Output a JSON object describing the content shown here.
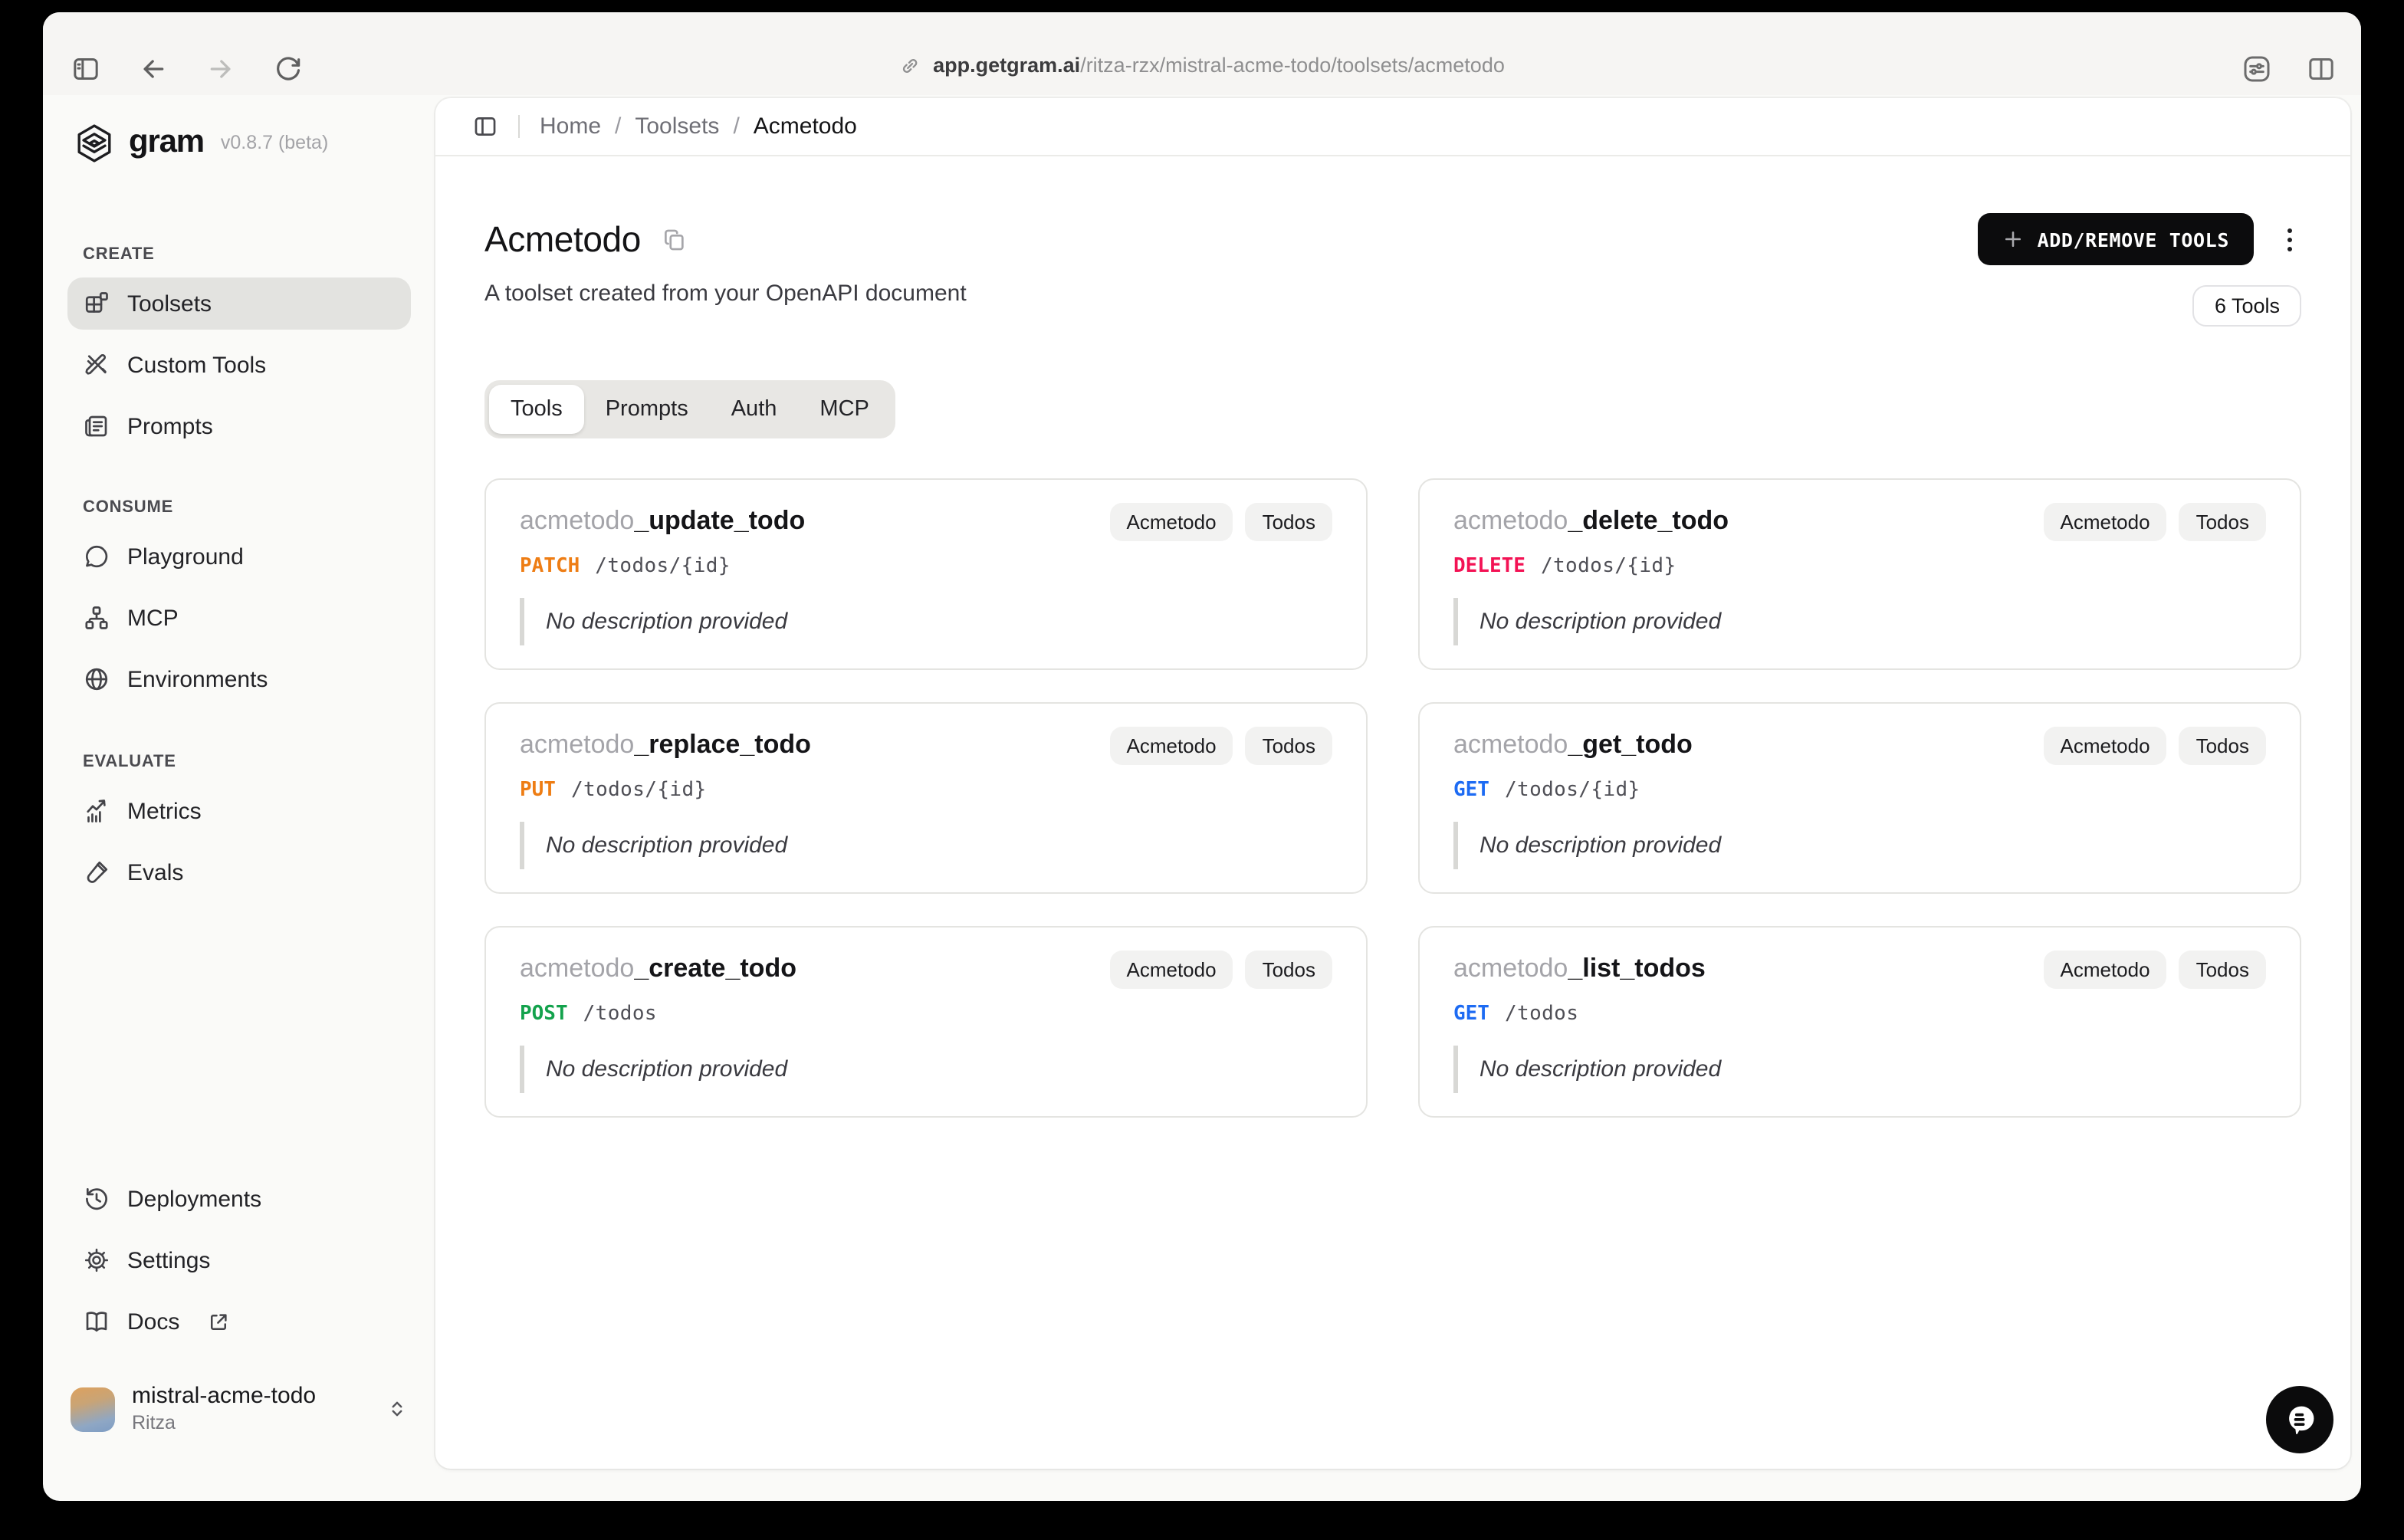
{
  "browser": {
    "url_host": "app.getgram.ai",
    "url_path": "/ritza-rzx/mistral-acme-todo/toolsets/acmetodo"
  },
  "sidebar": {
    "logo_text": "gram",
    "version": "v0.8.7 (beta)",
    "sections": [
      {
        "label": "CREATE",
        "items": [
          {
            "label": "Toolsets",
            "icon": "toolsets-icon",
            "active": true
          },
          {
            "label": "Custom Tools",
            "icon": "custom-tools-icon",
            "active": false
          },
          {
            "label": "Prompts",
            "icon": "prompts-icon",
            "active": false
          }
        ]
      },
      {
        "label": "CONSUME",
        "items": [
          {
            "label": "Playground",
            "icon": "playground-chat-icon",
            "active": false
          },
          {
            "label": "MCP",
            "icon": "mcp-network-icon",
            "active": false
          },
          {
            "label": "Environments",
            "icon": "environments-globe-icon",
            "active": false
          }
        ]
      },
      {
        "label": "EVALUATE",
        "items": [
          {
            "label": "Metrics",
            "icon": "metrics-chart-icon",
            "active": false
          },
          {
            "label": "Evals",
            "icon": "evals-testtube-icon",
            "active": false
          }
        ]
      }
    ],
    "footer_items": [
      {
        "label": "Deployments",
        "icon": "deployments-history-icon"
      },
      {
        "label": "Settings",
        "icon": "settings-gear-icon"
      },
      {
        "label": "Docs",
        "icon": "docs-book-icon",
        "external": true
      }
    ],
    "workspace": {
      "name": "mistral-acme-todo",
      "org": "Ritza"
    }
  },
  "header": {
    "separator": "/",
    "breadcrumbs": [
      {
        "label": "Home"
      },
      {
        "label": "Toolsets"
      },
      {
        "label": "Acmetodo"
      }
    ]
  },
  "main": {
    "title": "Acmetodo",
    "subtitle": "A toolset created from your OpenAPI document",
    "add_remove_label": "ADD/REMOVE TOOLS",
    "tools_count_badge": "6 Tools",
    "tabs": [
      {
        "label": "Tools",
        "active": true
      },
      {
        "label": "Prompts",
        "active": false
      },
      {
        "label": "Auth",
        "active": false
      },
      {
        "label": "MCP",
        "active": false
      }
    ],
    "cards": [
      {
        "prefix": "acmetodo",
        "name": "_update_todo",
        "method": "PATCH",
        "path": "/todos/{id}",
        "badges": [
          "Acmetodo",
          "Todos"
        ],
        "description": "No description provided"
      },
      {
        "prefix": "acmetodo",
        "name": "_delete_todo",
        "method": "DELETE",
        "path": "/todos/{id}",
        "badges": [
          "Acmetodo",
          "Todos"
        ],
        "description": "No description provided"
      },
      {
        "prefix": "acmetodo",
        "name": "_replace_todo",
        "method": "PUT",
        "path": "/todos/{id}",
        "badges": [
          "Acmetodo",
          "Todos"
        ],
        "description": "No description provided"
      },
      {
        "prefix": "acmetodo",
        "name": "_get_todo",
        "method": "GET",
        "path": "/todos/{id}",
        "badges": [
          "Acmetodo",
          "Todos"
        ],
        "description": "No description provided"
      },
      {
        "prefix": "acmetodo",
        "name": "_create_todo",
        "method": "POST",
        "path": "/todos",
        "badges": [
          "Acmetodo",
          "Todos"
        ],
        "description": "No description provided"
      },
      {
        "prefix": "acmetodo",
        "name": "_list_todos",
        "method": "GET",
        "path": "/todos",
        "badges": [
          "Acmetodo",
          "Todos"
        ],
        "description": "No description provided"
      }
    ]
  },
  "colors": {
    "method_get": "#1d6bf3",
    "method_post": "#13a24c",
    "method_put": "#ee7d14",
    "method_patch": "#ee7d14",
    "method_delete": "#f31254",
    "button_bg": "#0c0c0d",
    "sidebar_active_bg": "#e3e3e0"
  }
}
